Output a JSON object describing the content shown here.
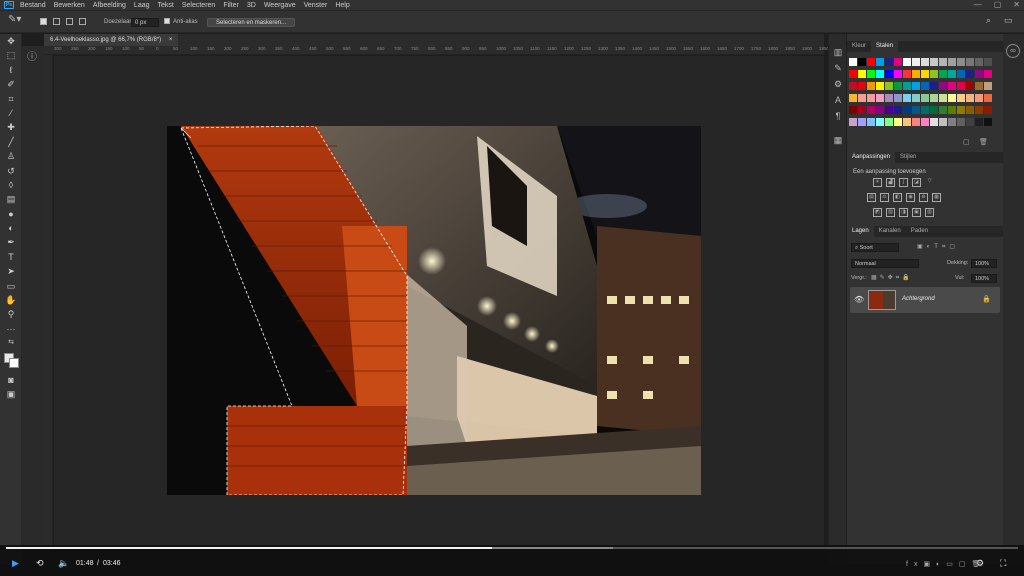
{
  "menubar": {
    "logo": "Ps",
    "items": [
      "Bestand",
      "Bewerken",
      "Afbeelding",
      "Laag",
      "Tekst",
      "Selecteren",
      "Filter",
      "3D",
      "Weergave",
      "Venster",
      "Help"
    ],
    "window_controls": [
      "—",
      "▢",
      "✕"
    ]
  },
  "options": {
    "feather_label": "Doezelaar:",
    "feather_value": "0 px",
    "antialias_label": "Anti-alias",
    "select_mask_button": "Selecteren en maskeren..."
  },
  "document": {
    "tab_title": "6.4-Veelhoeklasso.jpg @ 66,7% (RGB/8*)",
    "close": "×"
  },
  "ruler": {
    "ticks": [
      "300",
      "250",
      "200",
      "150",
      "100",
      "50",
      "0",
      "50",
      "100",
      "150",
      "200",
      "250",
      "300",
      "350",
      "400",
      "450",
      "500",
      "550",
      "600",
      "650",
      "700",
      "750",
      "800",
      "850",
      "900",
      "950",
      "1000",
      "1050",
      "1100",
      "1150",
      "1200",
      "1250",
      "1300",
      "1350",
      "1400",
      "1450",
      "1500",
      "1550",
      "1600",
      "1650",
      "1700",
      "1750",
      "1800",
      "1850",
      "1900",
      "1950"
    ]
  },
  "panels": {
    "color_tabs": [
      "Kleur",
      "Stalen"
    ],
    "swatch_colors": [
      [
        "#ffffff",
        "#000000",
        "#ff0000",
        "#00a0e9",
        "#1d2088",
        "#e4007f",
        "#ffffff",
        "#f0f0f0",
        "#dcdcdc",
        "#c8c8c8",
        "#b4b4b4",
        "#a0a0a0",
        "#8c8c8c",
        "#787878",
        "#646464",
        "#505050"
      ],
      [
        "#ff0000",
        "#ffff00",
        "#00ff00",
        "#00ffff",
        "#0000ff",
        "#ff00ff",
        "#ff3333",
        "#ffaa00",
        "#ffd700",
        "#8fc31f",
        "#00a650",
        "#00a99d",
        "#0068b7",
        "#1d2088",
        "#920783",
        "#e4007f"
      ],
      [
        "#c30d23",
        "#e60012",
        "#f39800",
        "#fff100",
        "#8fc31f",
        "#009944",
        "#009e96",
        "#00a0e9",
        "#0068b7",
        "#1d2088",
        "#920783",
        "#e4007f",
        "#e5004f",
        "#a40000",
        "#996c33",
        "#c0a080"
      ],
      [
        "#f8b62d",
        "#f4a090",
        "#f29c9f",
        "#f19ec2",
        "#aa89bd",
        "#8c97cb",
        "#7ecef4",
        "#84ccc9",
        "#89c997",
        "#acd598",
        "#cce198",
        "#fff799",
        "#facd89",
        "#f6b37f",
        "#f29b76",
        "#ec6941"
      ],
      [
        "#7d0000",
        "#a6001e",
        "#b40060",
        "#8a0089",
        "#4e0090",
        "#1f1a8a",
        "#003b83",
        "#005a8c",
        "#006e6a",
        "#006d38",
        "#2e7d32",
        "#5d7d00",
        "#8c7d00",
        "#8c5c00",
        "#8c3c00",
        "#8c1c00"
      ],
      [
        "#c8a2c8",
        "#a0a0ff",
        "#80c0ff",
        "#80ffff",
        "#80ff80",
        "#ffff80",
        "#ffc080",
        "#ff8080",
        "#ff80c0",
        "#e0e0e0",
        "#c0c0c0",
        "#808080",
        "#606060",
        "#404040",
        "#202020",
        "#101010"
      ]
    ],
    "adjust_tabs": [
      "Aanpassingen",
      "Stijlen"
    ],
    "adjust_hint": "Een aanpassing toevoegen",
    "layer_tabs": [
      "Lagen",
      "Kanalen",
      "Paden"
    ],
    "layer_search": "Soort",
    "blend_mode": "Normaal",
    "opacity_label": "Dekking:",
    "opacity_value": "100%",
    "lock_label": "Vergr.:",
    "fill_label": "Vul:",
    "fill_value": "100%",
    "layer_name": "Achtergrond"
  },
  "video": {
    "current_time": "01:48",
    "separator": "/",
    "duration": "03:46",
    "played_fraction": 0.48,
    "buffered_fraction": 0.6
  }
}
